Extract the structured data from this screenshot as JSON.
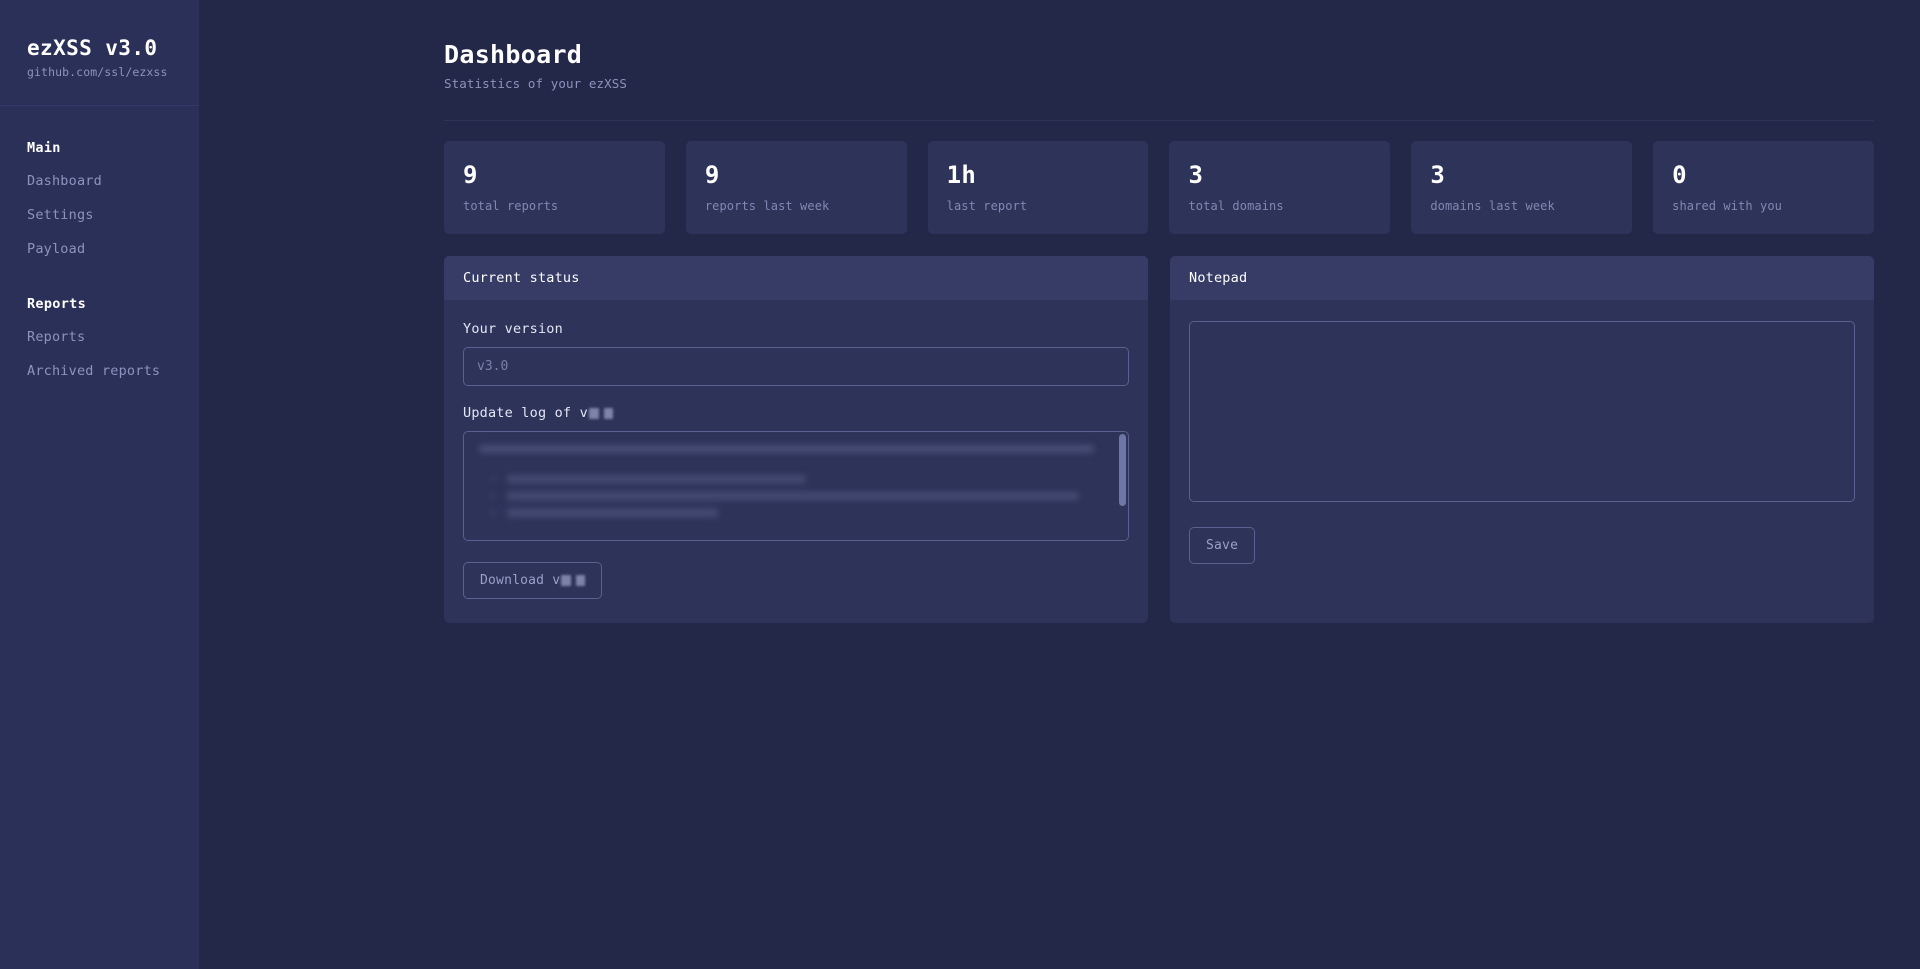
{
  "sidebar": {
    "brand_title": "ezXSS v3.0",
    "brand_subtitle": "github.com/ssl/ezxss",
    "groups": [
      {
        "title": "Main",
        "items": [
          {
            "label": "Dashboard"
          },
          {
            "label": "Settings"
          },
          {
            "label": "Payload"
          }
        ]
      },
      {
        "title": "Reports",
        "items": [
          {
            "label": "Reports"
          },
          {
            "label": "Archived reports"
          }
        ]
      }
    ]
  },
  "header": {
    "title": "Dashboard",
    "subtitle": "Statistics of your ezXSS"
  },
  "stats": [
    {
      "value": "9",
      "label": "total reports"
    },
    {
      "value": "9",
      "label": "reports last week"
    },
    {
      "value": "1h",
      "label": "last report"
    },
    {
      "value": "3",
      "label": "total domains"
    },
    {
      "value": "3",
      "label": "domains last week"
    },
    {
      "value": "0",
      "label": "shared with you"
    }
  ],
  "current_status": {
    "panel_title": "Current status",
    "version_label": "Your version",
    "version_value": "v3.0",
    "version_placeholder": "v3.0",
    "update_log_label": "Update log of v",
    "update_log_content": "",
    "download_label": "Download v"
  },
  "notepad": {
    "panel_title": "Notepad",
    "content": "",
    "placeholder": "",
    "save_label": "Save"
  },
  "colors": {
    "background": "#232748",
    "sidebar": "#2b3058",
    "panel": "#2d3359",
    "panel_header": "#363c66",
    "text_primary": "#ffffff",
    "text_muted": "#8d93bd",
    "border": "#5a6090"
  }
}
